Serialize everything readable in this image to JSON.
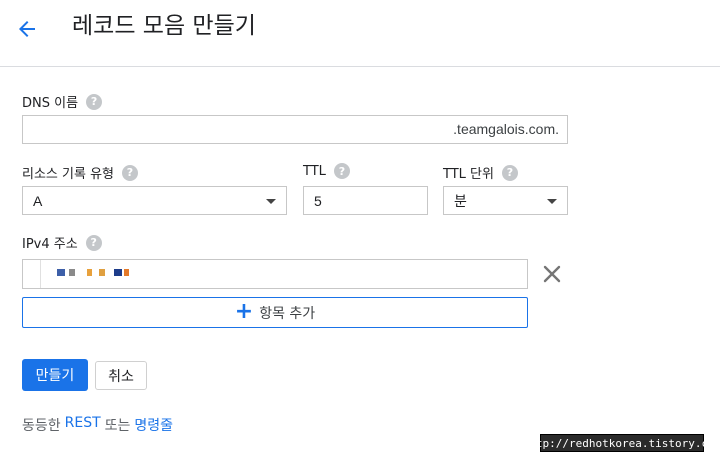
{
  "header": {
    "title": "레코드 모음 만들기",
    "back_icon": "arrow-back-icon"
  },
  "dns_name": {
    "label": "DNS 이름",
    "value": "",
    "suffix": ".teamgalois.com."
  },
  "record_type": {
    "label": "리소스 기록 유형",
    "value": "A"
  },
  "ttl": {
    "label": "TTL",
    "value": "5"
  },
  "ttl_unit": {
    "label": "TTL 단위",
    "value": "분"
  },
  "ipv4": {
    "label": "IPv4 주소",
    "value": ""
  },
  "help_glyph": "?",
  "add_item": {
    "label": "항목 추가",
    "plus": "+"
  },
  "buttons": {
    "create": "만들기",
    "cancel": "취소"
  },
  "footer": {
    "prefix": "동등한",
    "rest_link": "REST",
    "middle": "또는",
    "cli_link": "명령줄"
  },
  "watermark": "http://redhotkorea.tistory.com",
  "colors": {
    "accent": "#1a73e8",
    "border": "#c7c7c7",
    "help": "#c4c7ca"
  }
}
